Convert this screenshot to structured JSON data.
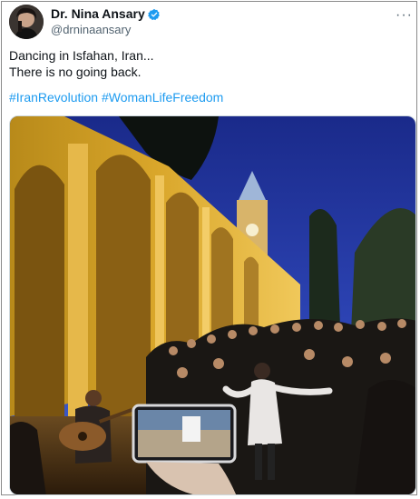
{
  "author": {
    "name": "Dr. Nina Ansary",
    "handle": "@drninaansary",
    "verified_icon": "verified-badge-icon",
    "verified_color": "#1d9bf0"
  },
  "menu_icon": "more-options-icon",
  "more_glyph": "···",
  "tweet": {
    "line1": "Dancing in Isfahan, Iran...",
    "line2": "There is no going back.",
    "hashtags": [
      "#IranRevolution",
      "#WomanLifeFreedom"
    ],
    "hashtag_color": "#1d9bf0"
  },
  "media": {
    "type": "video-still",
    "description_icon": "embedded-video"
  }
}
